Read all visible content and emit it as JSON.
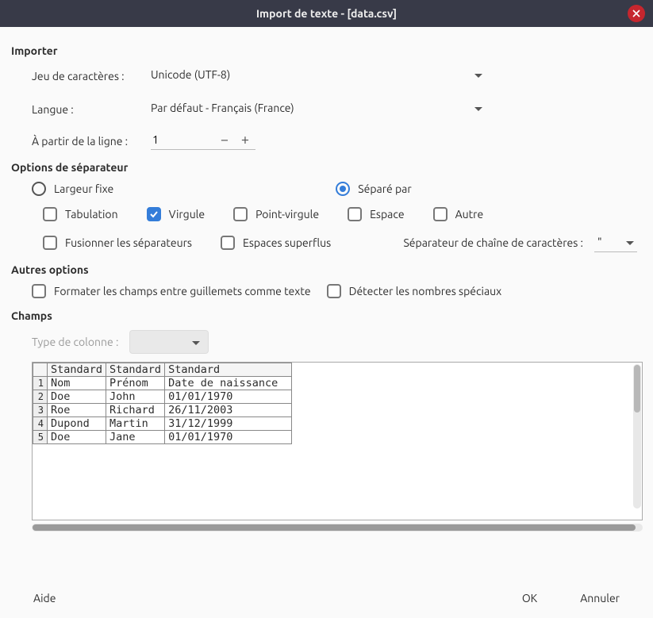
{
  "window": {
    "title": "Import de texte - [data.csv]"
  },
  "section_import": {
    "title": "Importer",
    "charset_label": "Jeu de caractères :",
    "charset_value": "Unicode (UTF-8)",
    "lang_label": "Langue :",
    "lang_value": "Par défaut - Français (France)",
    "from_row_label": "À partir de la ligne :",
    "from_row_value": "1"
  },
  "section_sep": {
    "title": "Options de séparateur",
    "fixed_width": "Largeur fixe",
    "separated_by": "Séparé par",
    "tab": "Tabulation",
    "comma": "Virgule",
    "semicolon": "Point-virgule",
    "space": "Espace",
    "other": "Autre",
    "merge": "Fusionner les séparateurs",
    "trim": "Espaces superflus",
    "string_delim_label": "Séparateur de chaîne de caractères :",
    "string_delim_value": "\""
  },
  "section_other": {
    "title": "Autres options",
    "quoted_as_text": "Formater les champs entre guillemets comme texte",
    "special_numbers": "Détecter les nombres spéciaux"
  },
  "section_fields": {
    "title": "Champs",
    "coltype_label": "Type de colonne :"
  },
  "preview": {
    "col_type": "Standard",
    "columns": 3,
    "rows": [
      [
        "Nom",
        "Prénom",
        "Date de naissance"
      ],
      [
        "Doe",
        "John",
        "01/01/1970"
      ],
      [
        "Roe",
        "Richard",
        "26/11/2003"
      ],
      [
        "Dupond",
        "Martin",
        "31/12/1999"
      ],
      [
        "Doe",
        "Jane",
        "01/01/1970"
      ]
    ]
  },
  "footer": {
    "help": "Aide",
    "ok": "OK",
    "cancel": "Annuler"
  }
}
